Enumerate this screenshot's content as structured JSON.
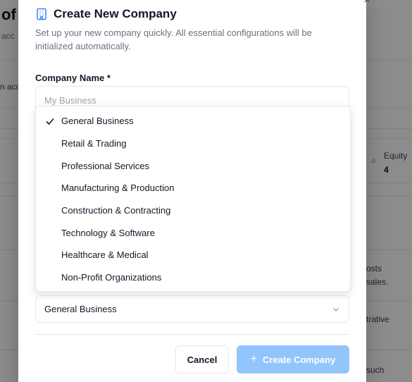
{
  "background": {
    "title": "of",
    "subtitle_fragment": "acc",
    "row_fragment": "n acc",
    "stat_label": "Equity",
    "stat_value": "4",
    "side_text_1": "osts",
    "side_text_2": "sales.",
    "side_text_3": "trative",
    "side_text_4": "such"
  },
  "modal": {
    "title": "Create New Company",
    "description": "Set up your new company quickly. All essential configurations will be initialized automatically.",
    "close_icon": "×",
    "company_name": {
      "label": "Company Name *",
      "placeholder": "My Business",
      "value": ""
    },
    "industry": {
      "selected": "General Business",
      "options": [
        "General Business",
        "Retail & Trading",
        "Professional Services",
        "Manufacturing & Production",
        "Construction & Contracting",
        "Technology & Software",
        "Healthcare & Medical",
        "Non-Profit Organizations"
      ]
    },
    "buttons": {
      "cancel": "Cancel",
      "create": "Create Company"
    }
  },
  "colors": {
    "accent": "#3b82f6",
    "primary_disabled": "#93c5fd",
    "overlay": "rgba(0,0,0,0.45)"
  },
  "icons": [
    "building-icon",
    "close-icon",
    "check-icon",
    "chevron-down-icon",
    "plus-icon"
  ]
}
